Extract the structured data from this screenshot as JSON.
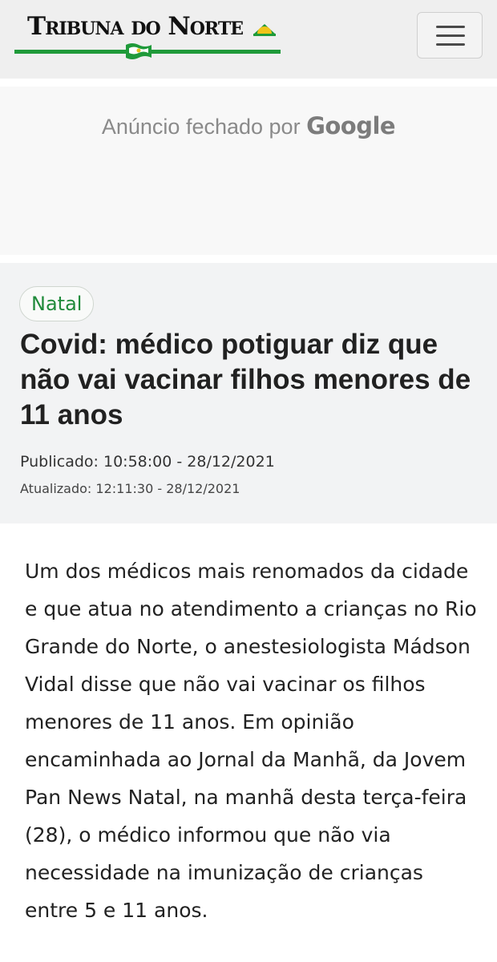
{
  "header": {
    "logo_text": "Tribuna do Norte",
    "logo_line_color": "#1f9a3a",
    "menu_icon": "hamburger-menu-icon"
  },
  "ad": {
    "text": "Anúncio fechado por",
    "brand": "Google"
  },
  "article": {
    "category": "Natal",
    "title": "Covid: médico potiguar diz que não vai vacinar filhos menores de 11 anos",
    "published": "Publicado: 10:58:00 - 28/12/2021",
    "updated": "Atualizado: 12:11:30 - 28/12/2021",
    "body": "Um dos médicos mais renomados da cidade e que atua no atendimento a crianças no Rio Grande do Norte, o anestesiologista Mádson Vidal disse que não vai vacinar os filhos menores de 11 anos. Em opinião encaminhada ao Jornal da Manhã, da Jovem Pan News Natal, na manhã desta terça-feira (28), o médico informou que não via necessidade na imunização de crianças entre 5 e 11 anos."
  },
  "colors": {
    "accent_green": "#1f8a3a",
    "header_bg": "#efefef",
    "article_header_bg": "#f2f3f4"
  }
}
